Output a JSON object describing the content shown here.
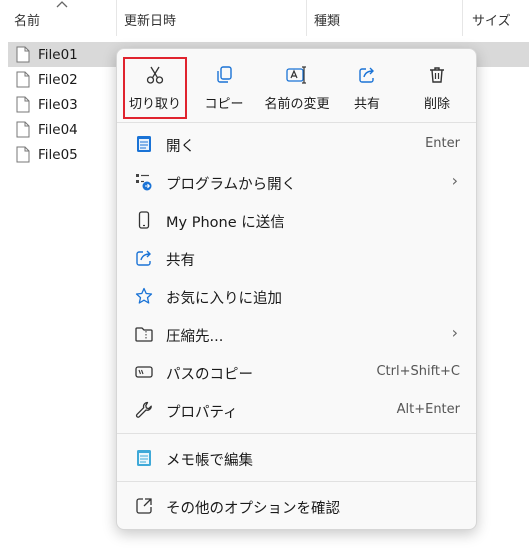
{
  "explorer": {
    "columns": [
      "名前",
      "更新日時",
      "種類",
      "サイズ"
    ],
    "files": [
      {
        "name": "File01",
        "selected": true
      },
      {
        "name": "File02",
        "selected": false
      },
      {
        "name": "File03",
        "selected": false
      },
      {
        "name": "File04",
        "selected": false
      },
      {
        "name": "File05",
        "selected": false
      }
    ]
  },
  "context_menu": {
    "toolbar": [
      {
        "label": "切り取り",
        "icon": "scissors-icon",
        "highlighted": true
      },
      {
        "label": "コピー",
        "icon": "copy-icon"
      },
      {
        "label": "名前の変更",
        "icon": "rename-icon"
      },
      {
        "label": "共有",
        "icon": "share-icon"
      },
      {
        "label": "削除",
        "icon": "trash-icon"
      }
    ],
    "items": [
      {
        "label": "開く",
        "shortcut": "Enter",
        "icon": "notepad-icon"
      },
      {
        "label": "プログラムから開く",
        "shortcut": "›",
        "icon": "open-with-icon"
      },
      {
        "label": "My Phone に送信",
        "shortcut": "",
        "icon": "phone-icon"
      },
      {
        "label": "共有",
        "shortcut": "",
        "icon": "share-icon"
      },
      {
        "label": "お気に入りに追加",
        "shortcut": "",
        "icon": "star-icon"
      },
      {
        "label": "圧縮先...",
        "shortcut": "›",
        "icon": "zip-folder-icon"
      },
      {
        "label": "パスのコピー",
        "shortcut": "Ctrl+Shift+C",
        "icon": "path-copy-icon"
      },
      {
        "label": "プロパティ",
        "shortcut": "Alt+Enter",
        "icon": "wrench-icon"
      },
      {
        "label": "メモ帳で編集",
        "shortcut": "",
        "icon": "notepad-icon"
      },
      {
        "label": "その他のオプションを確認",
        "shortcut": "",
        "icon": "more-options-icon"
      }
    ]
  },
  "colors": {
    "highlight": "#e0232e",
    "accent": "#1a73d6",
    "selected_row": "#d9d9d9"
  }
}
